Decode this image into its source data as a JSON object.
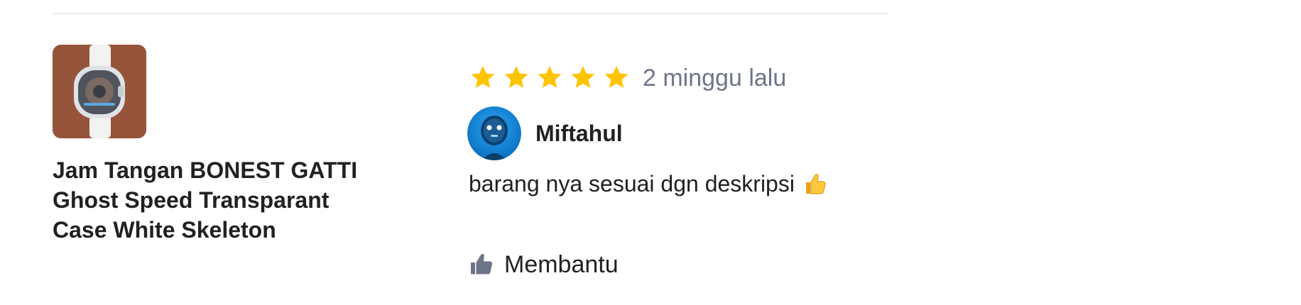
{
  "product": {
    "image_icon": "watch-thumbnail",
    "name": "Jam Tangan BONEST GATTI Ghost Speed Transparant Case White Skeleton"
  },
  "review": {
    "rating": 5,
    "rating_max": 5,
    "star_color": "#ffc400",
    "date": "2 minggu lalu",
    "reviewer": {
      "name": "Miftahul",
      "avatar_icon": "robot-avatar"
    },
    "text": "barang nya sesuai dgn deskripsi",
    "text_emoji": "👍",
    "helpful_label": "Membantu",
    "helpful_icon": "thumbs-up-icon"
  },
  "colors": {
    "text_primary": "#212121",
    "text_secondary": "#6d7588",
    "icon_gray": "#6d7588",
    "divider": "#ececec"
  }
}
